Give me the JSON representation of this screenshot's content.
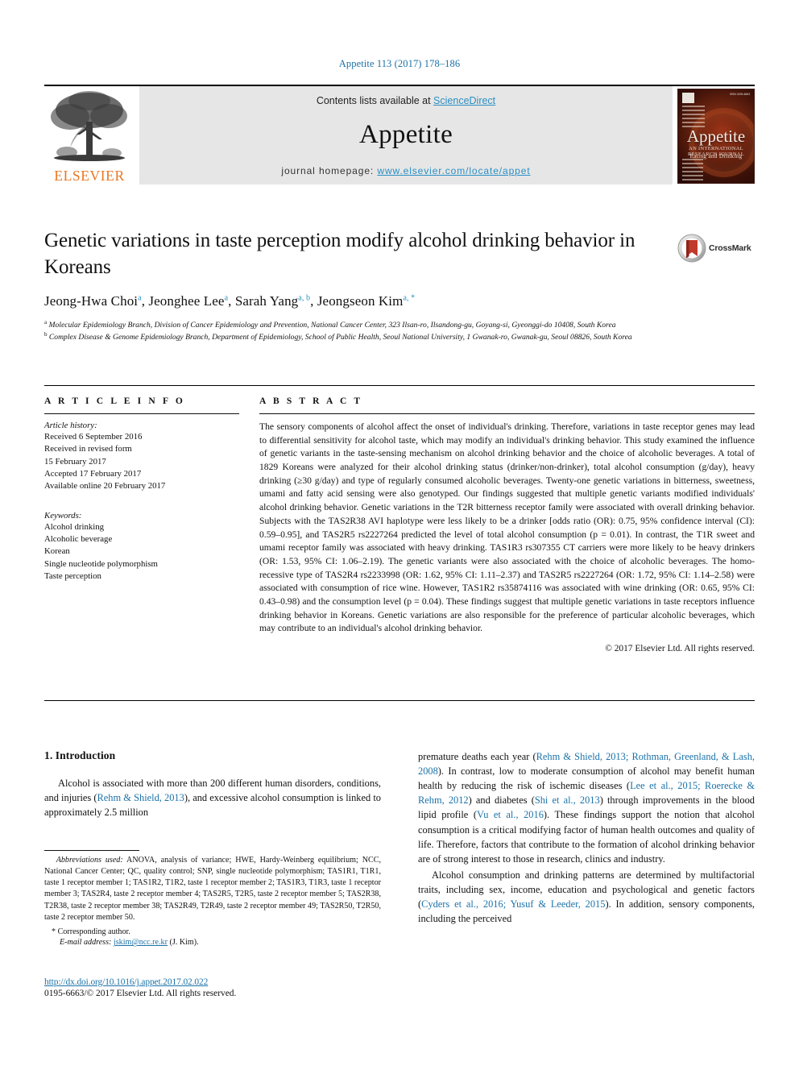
{
  "running_head": "Appetite 113 (2017) 178–186",
  "masthead": {
    "publisher_name": "ELSEVIER",
    "contents_prefix": "Contents lists available at ",
    "contents_link": "ScienceDirect",
    "journal_name": "Appetite",
    "homepage_prefix": "journal homepage: ",
    "homepage_url": "www.elsevier.com/locate/appet",
    "cover": {
      "title": "Appetite",
      "subtitle": "AN INTERNATIONAL RESEARCH JOURNAL",
      "subtitle2": "Eating and Drinking",
      "issue_code": "ISSN 0195-6663"
    }
  },
  "article": {
    "title": "Genetic variations in taste perception modify alcohol drinking behavior in Koreans",
    "authors": [
      {
        "name": "Jeong-Hwa Choi",
        "marks": "a"
      },
      {
        "name": "Jeonghee Lee",
        "marks": "a"
      },
      {
        "name": "Sarah Yang",
        "marks": "a, b"
      },
      {
        "name": "Jeongseon Kim",
        "marks": "a, *"
      }
    ],
    "authors_line": "Jeong-Hwa Choi a, Jeonghee Lee a, Sarah Yang a, b, Jeongseon Kim a, *",
    "affiliations": [
      {
        "mark": "a",
        "text": "Molecular Epidemiology Branch, Division of Cancer Epidemiology and Prevention, National Cancer Center, 323 Ilsan-ro, Ilsandong-gu, Goyang-si, Gyeonggi-do 10408, South Korea"
      },
      {
        "mark": "b",
        "text": "Complex Disease & Genome Epidemiology Branch, Department of Epidemiology, School of Public Health, Seoul National University, 1 Gwanak-ro, Gwanak-gu, Seoul 08826, South Korea"
      }
    ],
    "crossmark_label": "CrossMark"
  },
  "article_info": {
    "heading": "A R T I C L E   I N F O",
    "history_label": "Article history:",
    "history": [
      "Received 6 September 2016",
      "Received in revised form",
      "15 February 2017",
      "Accepted 17 February 2017",
      "Available online 20 February 2017"
    ],
    "keywords_label": "Keywords:",
    "keywords": [
      "Alcohol drinking",
      "Alcoholic beverage",
      "Korean",
      "Single nucleotide polymorphism",
      "Taste perception"
    ]
  },
  "abstract": {
    "heading": "A B S T R A C T",
    "text": "The sensory components of alcohol affect the onset of individual's drinking. Therefore, variations in taste receptor genes may lead to differential sensitivity for alcohol taste, which may modify an individual's drinking behavior. This study examined the influence of genetic variants in the taste-sensing mechanism on alcohol drinking behavior and the choice of alcoholic beverages. A total of 1829 Koreans were analyzed for their alcohol drinking status (drinker/non-drinker), total alcohol consumption (g/day), heavy drinking (≥30 g/day) and type of regularly consumed alcoholic beverages. Twenty-one genetic variations in bitterness, sweetness, umami and fatty acid sensing were also genotyped. Our findings suggested that multiple genetic variants modified individuals' alcohol drinking behavior. Genetic variations in the T2R bitterness receptor family were associated with overall drinking behavior. Subjects with the TAS2R38 AVI haplotype were less likely to be a drinker [odds ratio (OR): 0.75, 95% confidence interval (CI): 0.59–0.95], and TAS2R5 rs2227264 predicted the level of total alcohol consumption (p = 0.01). In contrast, the T1R sweet and umami receptor family was associated with heavy drinking. TAS1R3 rs307355 CT carriers were more likely to be heavy drinkers (OR: 1.53, 95% CI: 1.06–2.19). The genetic variants were also associated with the choice of alcoholic beverages. The homo-recessive type of TAS2R4 rs2233998 (OR: 1.62, 95% CI: 1.11–2.37) and TAS2R5 rs2227264 (OR: 1.72, 95% CI: 1.14–2.58) were associated with consumption of rice wine. However, TAS1R2 rs35874116 was associated with wine drinking (OR: 0.65, 95% CI: 0.43–0.98) and the consumption level (p = 0.04). These findings suggest that multiple genetic variations in taste receptors influence drinking behavior in Koreans. Genetic variations are also responsible for the preference of particular alcoholic beverages, which may contribute to an individual's alcohol drinking behavior.",
    "copyright": "© 2017 Elsevier Ltd. All rights reserved."
  },
  "introduction": {
    "heading": "1. Introduction",
    "left_para_1": "Alcohol is associated with more than 200 different human disorders, conditions, and injuries (Rehm & Shield, 2013), and excessive alcohol consumption is linked to approximately 2.5 million",
    "right_para_1": "premature deaths each year (Rehm & Shield, 2013; Rothman, Greenland, & Lash, 2008). In contrast, low to moderate consumption of alcohol may benefit human health by reducing the risk of ischemic diseases (Lee et al., 2015; Roerecke & Rehm, 2012) and diabetes (Shi et al., 2013) through improvements in the blood lipid profile (Vu et al., 2016). These findings support the notion that alcohol consumption is a critical modifying factor of human health outcomes and quality of life. Therefore, factors that contribute to the formation of alcohol drinking behavior are of strong interest to those in research, clinics and industry.",
    "right_para_2": "Alcohol consumption and drinking patterns are determined by multifactorial traits, including sex, income, education and psychological and genetic factors (Cyders et al., 2016; Yusuf & Leeder, 2015). In addition, sensory components, including the perceived"
  },
  "footnote": {
    "abbrev_label": "Abbreviations used:",
    "abbrev_text": "ANOVA, analysis of variance; HWE, Hardy-Weinberg equilibrium; NCC, National Cancer Center; QC, quality control; SNP, single nucleotide polymorphism; TAS1R1, T1R1, taste 1 receptor member 1; TAS1R2, T1R2, taste 1 receptor member 2; TAS1R3, T1R3, taste 1 receptor member 3; TAS2R4, taste 2 receptor member 4; TAS2R5, T2R5, taste 2 receptor member 5; TAS2R38, T2R38, taste 2 receptor member 38; TAS2R49, T2R49, taste 2 receptor member 49; TAS2R50, T2R50, taste 2 receptor member 50.",
    "corresponding": "* Corresponding author.",
    "email_label": "E-mail address:",
    "email": "jskim@ncc.re.kr",
    "email_author": "(J. Kim)."
  },
  "doi_footer": {
    "doi_url": "http://dx.doi.org/10.1016/j.appet.2017.02.022",
    "issn_line": "0195-6663/© 2017 Elsevier Ltd. All rights reserved."
  },
  "colors": {
    "link_blue": "#1b72a8",
    "sd_blue": "#2b8fc4",
    "elsevier_orange": "#e87722",
    "masthead_grey": "#e6e6e6"
  }
}
